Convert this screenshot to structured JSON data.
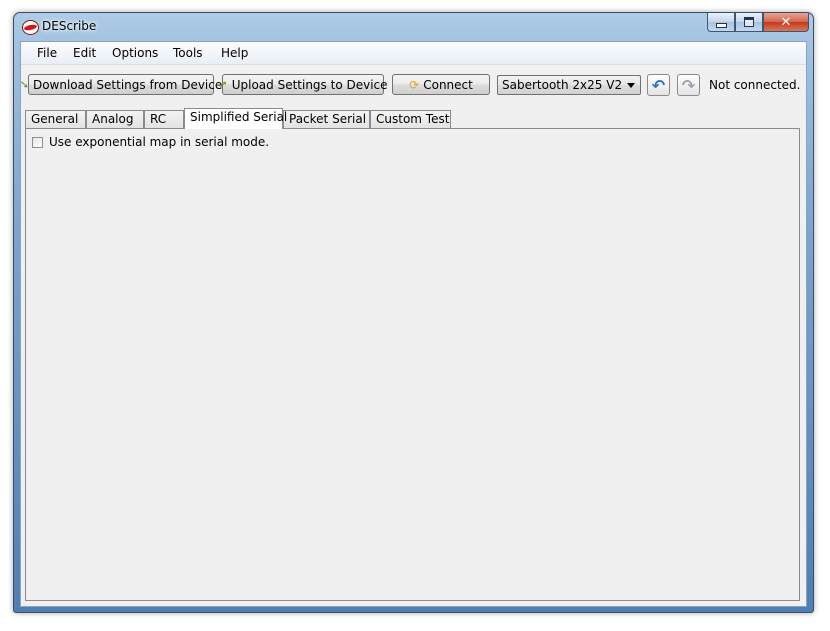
{
  "window": {
    "title": "DEScribe"
  },
  "menu": {
    "items": [
      "File",
      "Edit",
      "Options",
      "Tools",
      "Help"
    ]
  },
  "toolbar": {
    "download_label": "Download Settings from Device",
    "upload_label": "Upload Settings to Device",
    "connect_label": "Connect",
    "device_select_value": "Sabertooth 2x25 V2",
    "status_text": "Not connected."
  },
  "tabs": {
    "items": [
      "General",
      "Analog",
      "RC",
      "Simplified Serial",
      "Packet Serial",
      "Custom Test"
    ],
    "active": "Simplified Serial"
  },
  "panel": {
    "exponential_checkbox_label": "Use exponential map in serial mode.",
    "exponential_checked": false
  },
  "colors": {
    "window_frame": "#7ea6cf",
    "client_background": "#f0f0f0",
    "close_button": "#c23a1d",
    "undo_icon": "#2a74c8"
  },
  "icons": {
    "download": "download-arrow-icon",
    "upload": "upload-arrow-icon",
    "connect": "refresh-icon",
    "undo": "undo-arrow-icon",
    "redo": "redo-arrow-icon"
  }
}
